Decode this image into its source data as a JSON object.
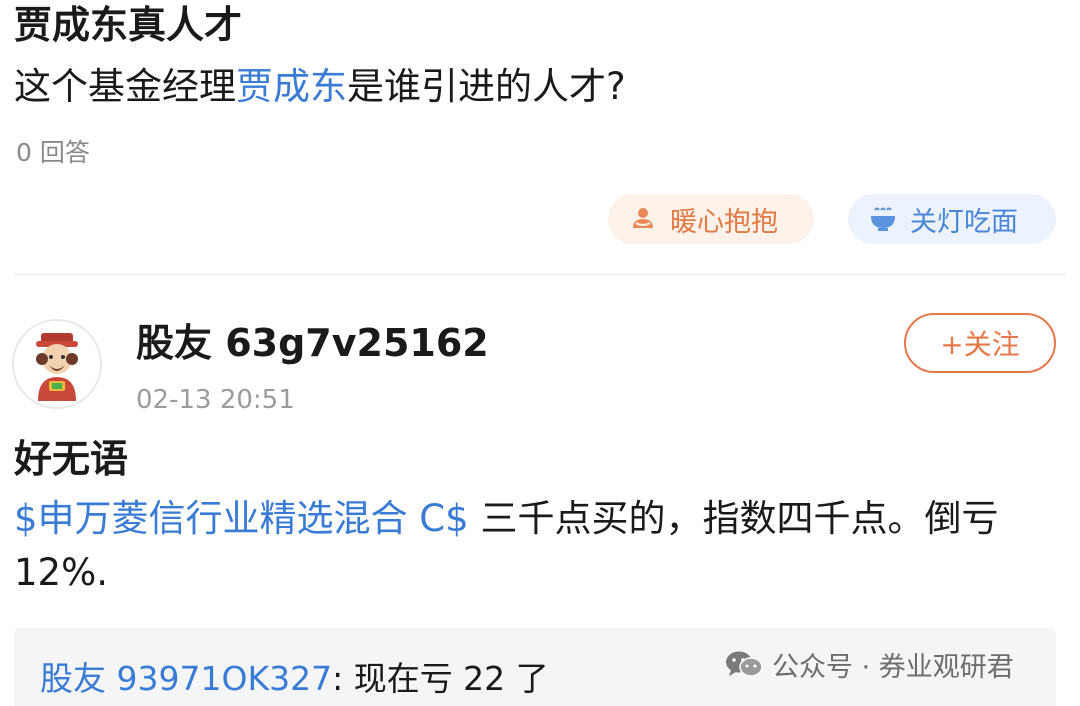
{
  "question": {
    "title": "贾成东真人才",
    "body_prefix": "这个基金经理",
    "body_link": "贾成东",
    "body_suffix": "是谁引进的人才?",
    "answer_count": "0 回答"
  },
  "reactions": [
    {
      "label": "暖心抱抱",
      "icon": "hug-icon",
      "color": "#e27a45"
    },
    {
      "label": "关灯吃面",
      "icon": "noodle-bowl-icon",
      "color": "#4a86d8"
    }
  ],
  "post": {
    "username": "股友 63g7v25162",
    "timestamp": "02-13 20:51",
    "follow_label": "+关注",
    "title": "好无语",
    "fund_link": "$申万菱信行业精选混合 C$",
    "body_text": " 三千点买的，指数四千点。倒亏12%."
  },
  "reply": {
    "user": "股友 93971OK327",
    "separator": ": ",
    "text": "现在亏 22 了"
  },
  "watermark": {
    "text": "公众号 · 券业观研君"
  },
  "colors": {
    "link": "#3a7bd5",
    "accent_orange": "#e5784a",
    "muted_text": "#8a8a8a"
  }
}
